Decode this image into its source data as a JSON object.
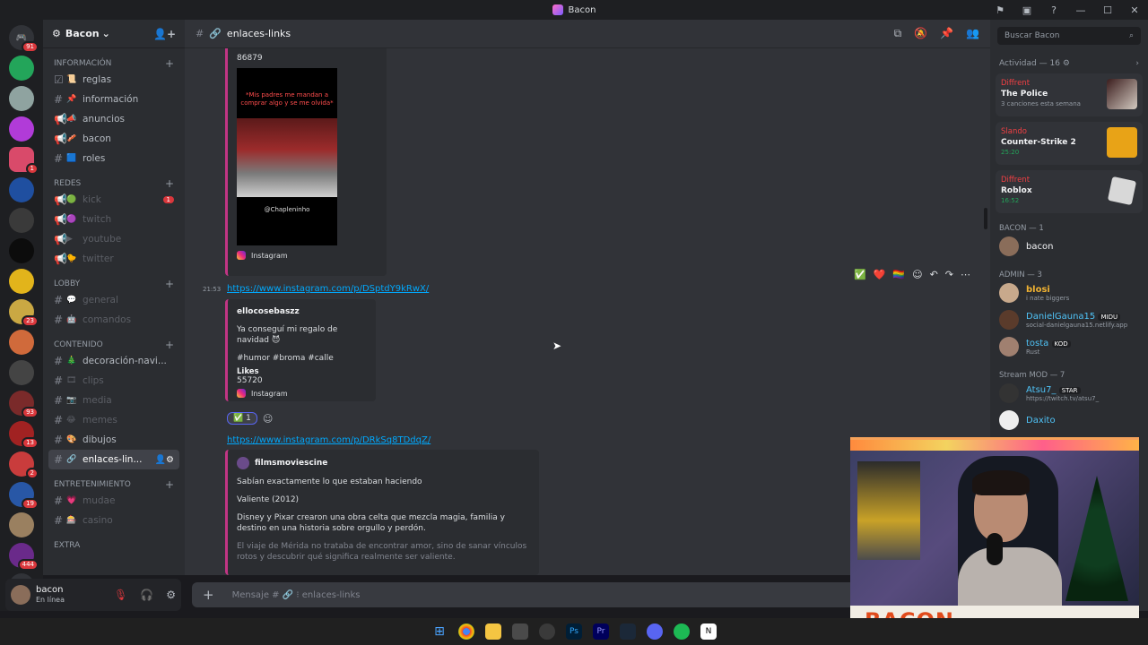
{
  "window": {
    "title": "Bacon"
  },
  "server": {
    "name": "Bacon"
  },
  "guild_badges": [
    "91",
    "1",
    "23",
    "93",
    "13",
    "2",
    "19",
    "444"
  ],
  "categories": {
    "info": "INFORMACIÓN",
    "redes": "REDES",
    "lobby": "LOBBY",
    "contenido": "CONTENIDO",
    "entretenimiento": "ENTRETENIMIENTO",
    "extra": "EXTRA"
  },
  "channels": {
    "reglas": "reglas",
    "informacion": "información",
    "anuncios": "anuncios",
    "bacon": "bacon",
    "roles": "roles",
    "kick": "kick",
    "kick_badge": "1",
    "twitch": "twitch",
    "youtube": "youtube",
    "twitter": "twitter",
    "general": "general",
    "comandos": "comandos",
    "decoracion": "decoración-navi...",
    "clips": "clips",
    "media": "media",
    "memes": "memes",
    "dibujos": "dibujos",
    "enlaces": "enlaces-lin...",
    "mudae": "mudae",
    "casino": "casino"
  },
  "user_panel": {
    "name": "bacon",
    "status": "En línea"
  },
  "chat_header": {
    "channel": "enlaces-links"
  },
  "messages": {
    "embed1_likes": "86879",
    "embed1_caption": "*Mis padres me mandan a comprar algo y se me olvida*",
    "embed1_handle": "@Chapleninho",
    "instagram": "Instagram",
    "time2": "21:53",
    "link2": "https://www.instagram.com/p/DSptdY9kRwX/",
    "embed2_author": "ellocosebaszz",
    "embed2_text": "Ya conseguí mi regalo de navidad 😈",
    "embed2_tags": "#humor #broma #calle",
    "embed2_likes_label": "Likes",
    "embed2_likes": "55720",
    "reaction_count": "1",
    "link3": "https://www.instagram.com/p/DRkSq8TDdqZ/",
    "embed3_author": "filmsmoviescine",
    "embed3_p1": "Sabían exactamente lo que estaban haciendo",
    "embed3_p2": "Valiente (2012)",
    "embed3_p3": "Disney y Pixar crearon una obra celta que mezcla magia, familia y destino en una historia sobre orgullo y perdón.",
    "embed3_p4": "El viaje de Mérida no trataba de encontrar amor, sino de sanar vínculos rotos y descubrir qué significa realmente ser valiente."
  },
  "composer": {
    "placeholder": "Mensaje # 🔗 ⁝ enlaces-links"
  },
  "member_list": {
    "search_placeholder": "Buscar Bacon",
    "activity_title": "Actividad — 16",
    "activities": [
      {
        "who": "Diffrent",
        "what": "The Police",
        "sub": "3 canciones esta semana"
      },
      {
        "who": "Slando",
        "what": "Counter-Strike 2",
        "sub": "25:20"
      },
      {
        "who": "Diffrent",
        "what": "Roblox",
        "sub": "16:52"
      }
    ],
    "group_bacon": "BACON — 1",
    "member_bacon": "bacon",
    "group_admin": "ADMIN — 3",
    "admins": [
      {
        "name": "blosi",
        "sub": "i nate biggers"
      },
      {
        "name": "DanielGauna15",
        "tag": "MIDU",
        "sub": "social-danielgauna15.netlify.app"
      },
      {
        "name": "tosta",
        "tag": "KOD",
        "sub": "Rust"
      }
    ],
    "group_mod": "Stream MOD — 7",
    "mods": [
      {
        "name": "Atsu7_",
        "tag": "STAR",
        "sub": "https://twitch.tv/atsu7_"
      },
      {
        "name": "Daxito",
        "sub": ""
      }
    ]
  },
  "webcam": {
    "banner": "BACON"
  },
  "colors": {
    "accent": "#5865f2",
    "link": "#00a8fc",
    "danger": "#da373c",
    "instagram_border": "#c13584"
  }
}
